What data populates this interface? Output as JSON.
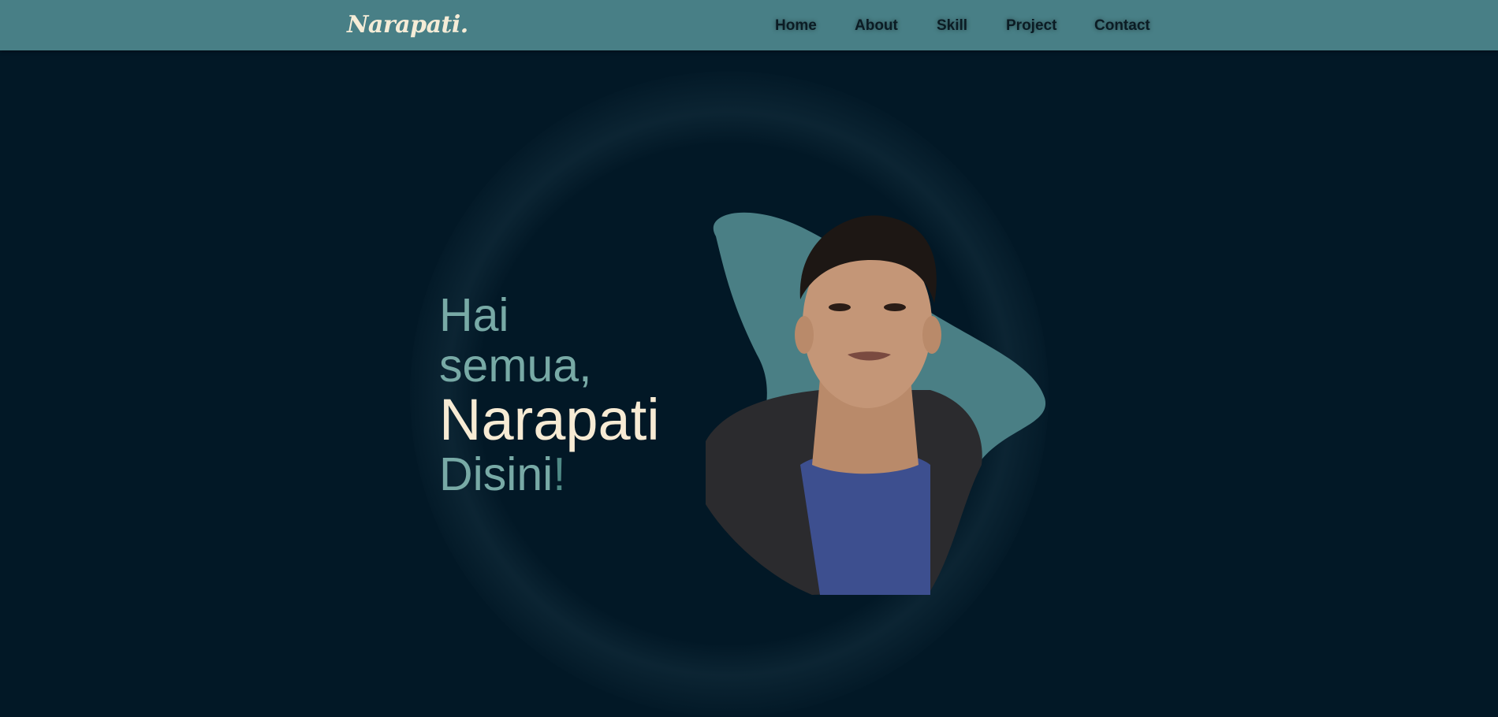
{
  "navbar": {
    "logo": "Narapati.",
    "links": [
      "Home",
      "About",
      "Skill",
      "Project",
      "Contact"
    ]
  },
  "hero": {
    "line1": "Hai",
    "line2": "semua,",
    "name": "Narapati",
    "line4": "Disini",
    "exclamation": "!"
  },
  "colors": {
    "background": "#021826",
    "navbar": "#487f86",
    "accent_text": "#78aaa6",
    "name_text": "#f7ebd4",
    "blob": "#4a7f85"
  }
}
